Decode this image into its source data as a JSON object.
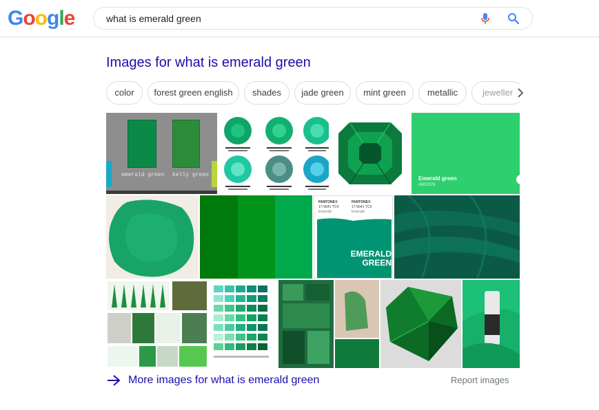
{
  "logo": {
    "letters": [
      {
        "char": "G",
        "color": "#4285F4"
      },
      {
        "char": "o",
        "color": "#EA4335"
      },
      {
        "char": "o",
        "color": "#FBBC05"
      },
      {
        "char": "g",
        "color": "#4285F4"
      },
      {
        "char": "l",
        "color": "#34A853"
      },
      {
        "char": "e",
        "color": "#EA4335"
      }
    ]
  },
  "search": {
    "query": "what is emerald green",
    "mic_icon": "microphone-icon",
    "search_icon": "magnifier-icon"
  },
  "images": {
    "heading": "Images for what is emerald green",
    "chips": [
      "color",
      "forest green english",
      "shades",
      "jade green",
      "mint green",
      "metallic",
      "jeweller"
    ],
    "chips_next_icon": "chevron-right-icon",
    "tiles": {
      "t1": {
        "label_a": "emerald green",
        "label_b": "kelly green"
      },
      "t3": {
        "title": "Emerald green",
        "code": "#50C878"
      },
      "t7": {
        "brand_a": "PANTONE®",
        "code_a": "17-5641 TCX",
        "name_a": "Emerald",
        "brand_b": "PANTONE®",
        "code_b": "17-5641 TCX",
        "name_b": "Emerald",
        "overlay_1": "EMERALD",
        "overlay_2": "GREEN"
      }
    },
    "more_link": "More images for what is emerald green",
    "more_icon": "arrow-right-icon",
    "report": "Report images"
  },
  "colors": {
    "link": "#1a0dab",
    "emerald": "#50C878",
    "pantone_emerald": "#009473"
  }
}
